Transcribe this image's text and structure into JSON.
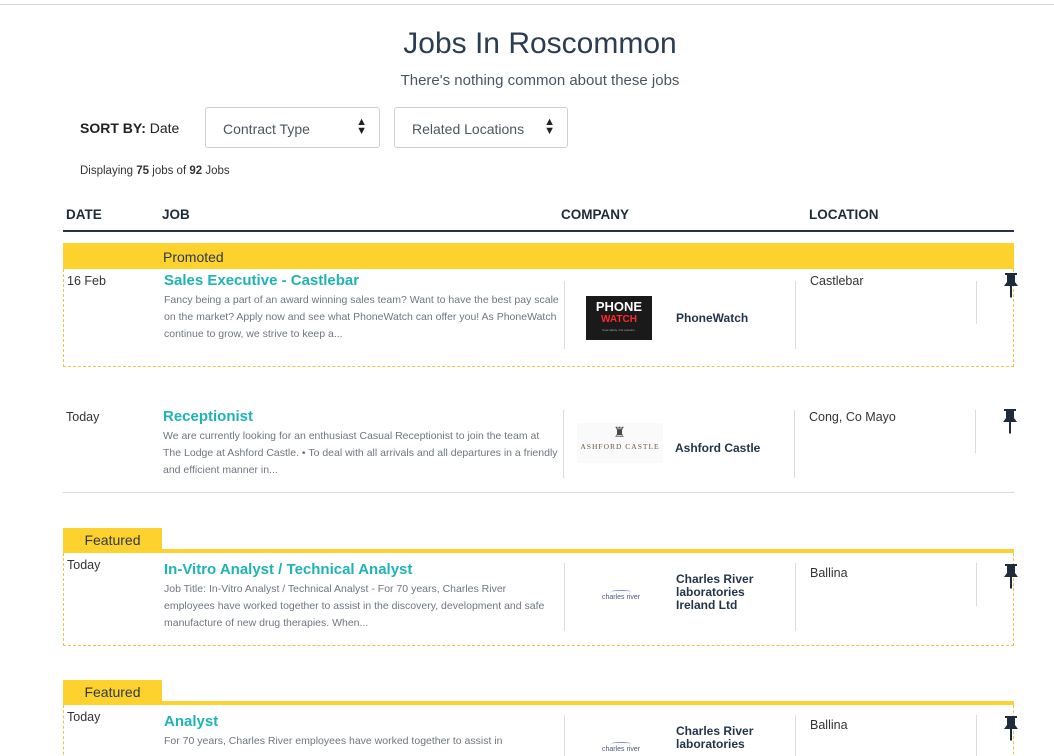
{
  "page": {
    "title": "Jobs In Roscommon",
    "subtitle": "There's nothing common about these jobs"
  },
  "filters": {
    "sort_by_label": "SORT BY:",
    "sort_by_value": "Date",
    "contract_type": "Contract Type",
    "related_locations": "Related Locations"
  },
  "summary": {
    "prefix": "Displaying",
    "shown": "75",
    "middle": "jobs of",
    "total": "92",
    "suffix": "Jobs"
  },
  "table": {
    "headers": {
      "date": "DATE",
      "job": "JOB",
      "company": "COMPANY",
      "location": "LOCATION"
    }
  },
  "labels": {
    "promoted": "Promoted",
    "featured": "Featured"
  },
  "jobs": [
    {
      "date": "16 Feb",
      "title": "Sales Executive - Castlebar",
      "description": "Fancy being a part of an award winning sales team? Want to have the best pay scale on the market? Apply now and see what PhoneWatch can offer you! As PhoneWatch continue to grow, we strive to keep a...",
      "company": "PhoneWatch",
      "location": "Castlebar",
      "logo_text": {
        "line1": "PHONE",
        "line2": "WATCH",
        "tag": "Feel safety. Our passion."
      }
    },
    {
      "date": "Today",
      "title": "Receptionist",
      "description": "We are currently looking for an enthusiast Casual Receptionist to join the team at The Lodge at Ashford Castle. • To deal with all arrivals and all departures in a friendly and efficient manner in...",
      "company": "Ashford Castle",
      "location": "Cong, Co Mayo",
      "logo_text": "ASHFORD CASTLE"
    },
    {
      "date": "Today",
      "title": "In-Vitro Analyst / Technical Analyst",
      "description": "Job Title: In-Vitro Analyst / Technical Analyst - For 70 years, Charles River employees have worked together to assist in the discovery, development and safe manufacture of new drug therapies. When...",
      "company": "Charles River laboratories Ireland Ltd",
      "location": "Ballina",
      "logo_text": "charles river"
    },
    {
      "date": "Today",
      "title": "Analyst",
      "description": "For 70 years, Charles River employees have worked together to assist in",
      "company": "Charles River laboratories",
      "location": "Ballina",
      "logo_text": "charles river"
    }
  ],
  "colors": {
    "accent_yellow": "#fdd12e",
    "title_teal": "#1fb3b5",
    "navy": "#243446"
  }
}
